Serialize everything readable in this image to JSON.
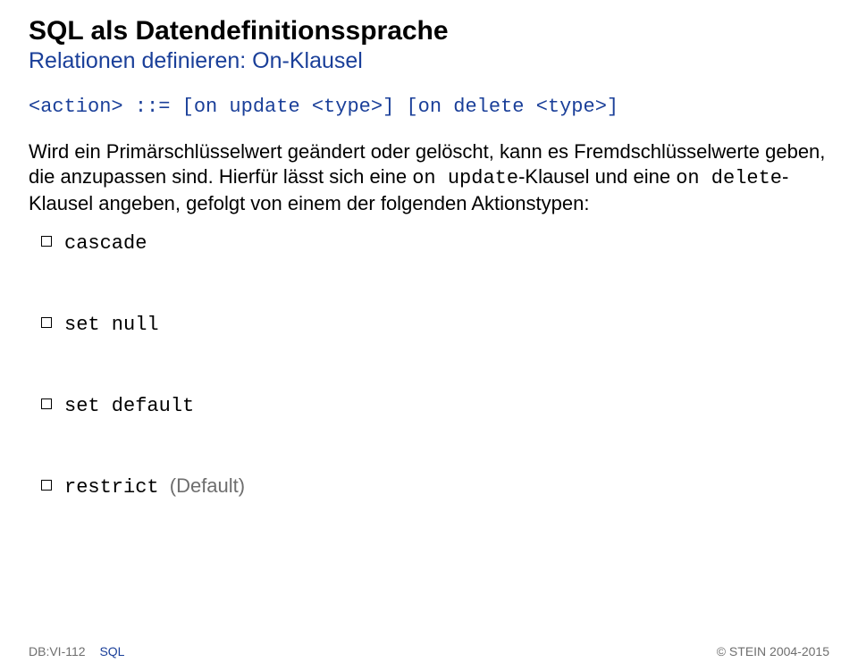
{
  "title": "SQL als Datendefinitionssprache",
  "subtitle": "Relationen definieren: On-Klausel",
  "syntax": "<action> ::= [on update <type>] [on delete <type>]",
  "para1_pre": "Wird ein Primärschlüsselwert geändert oder gelöscht, kann es Fremdschlüsselwerte geben, die anzupassen sind. Hierfür lässt sich eine ",
  "para1_code1": "on update",
  "para1_mid1": "-Klausel und eine ",
  "para1_code2": "on delete",
  "para1_mid2": "-Klausel angeben, gefolgt von einem der folgenden Aktionstypen:",
  "items": [
    {
      "label": "cascade",
      "note": ""
    },
    {
      "label": "set null",
      "note": ""
    },
    {
      "label": "set default",
      "note": ""
    },
    {
      "label": "restrict",
      "note": "(Default)"
    }
  ],
  "footer": {
    "id": "DB:VI-112",
    "label": "SQL",
    "copyright": "© STEIN 2004-2015"
  }
}
